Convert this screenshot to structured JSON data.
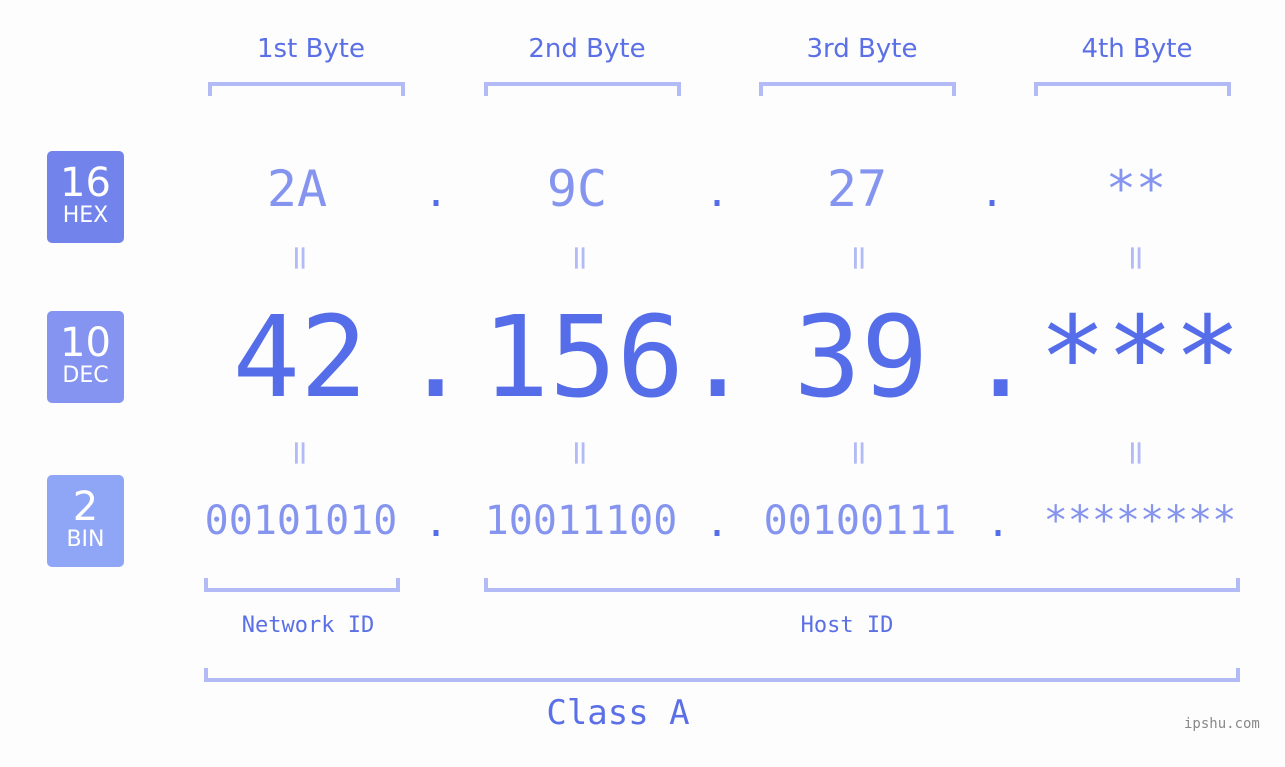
{
  "bytes": [
    {
      "label": "1st Byte",
      "hex": "2A",
      "dec": "42",
      "bin": "00101010"
    },
    {
      "label": "2nd Byte",
      "hex": "9C",
      "dec": "156",
      "bin": "10011100"
    },
    {
      "label": "3rd Byte",
      "hex": "27",
      "dec": "39",
      "bin": "00100111"
    },
    {
      "label": "4th Byte",
      "hex": "**",
      "dec": "***",
      "bin": "********"
    }
  ],
  "badges": {
    "hex": {
      "num": "16",
      "label": "HEX",
      "color": "#7383ec"
    },
    "dec": {
      "num": "10",
      "label": "DEC",
      "color": "#8594f0"
    },
    "bin": {
      "num": "2",
      "label": "BIN",
      "color": "#8fa6f7"
    }
  },
  "separator": ".",
  "equals": "=",
  "segments": {
    "network": "Network ID",
    "host": "Host ID",
    "class": "Class A"
  },
  "watermark": "ipshu.com",
  "colors": {
    "accent": "#556de9",
    "light": "#8595ef",
    "bracket": "#b3bbf6",
    "background": "#fcfdfc"
  }
}
